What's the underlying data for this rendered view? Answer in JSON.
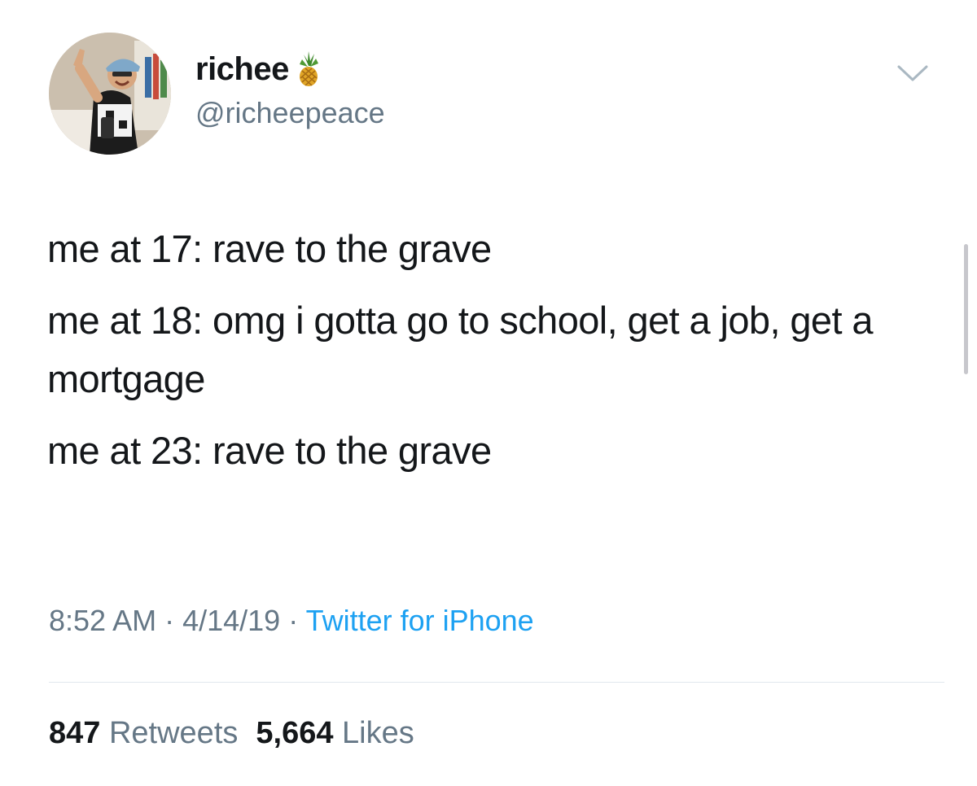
{
  "tweet": {
    "author": {
      "display_name": "richee",
      "handle": "@richeepeace",
      "badge_emoji": "pineapple-icon"
    },
    "lines": [
      "me at 17: rave to the grave",
      "me at 18: omg i gotta go to school, get a job, get a mortgage",
      "me at 23: rave to the grave"
    ],
    "meta": {
      "time": "8:52 AM",
      "separator": " · ",
      "date": "4/14/19",
      "source": "Twitter for iPhone"
    },
    "stats": {
      "retweets_count": "847",
      "retweets_label": "Retweets",
      "likes_count": "5,664",
      "likes_label": "Likes"
    }
  },
  "colors": {
    "text_primary": "#14171a",
    "text_secondary": "#657786",
    "link": "#1da1f2",
    "divider": "#e1e8ed"
  },
  "icons": {
    "menu": "chevron-down-icon"
  }
}
